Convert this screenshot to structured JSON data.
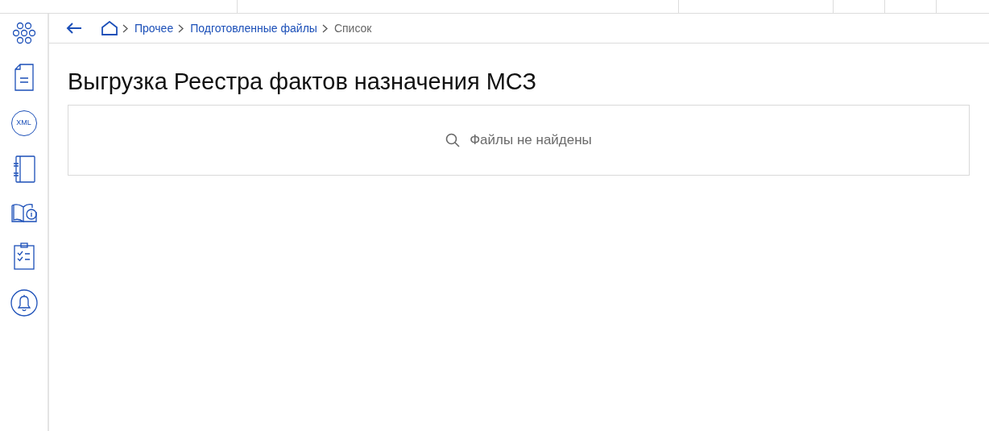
{
  "breadcrumbs": [
    {
      "label": "Прочее",
      "current": false
    },
    {
      "label": "Подготовленные файлы",
      "current": false
    },
    {
      "label": "Список",
      "current": true
    }
  ],
  "sidebar": {
    "items": [
      {
        "kind": "apps"
      },
      {
        "kind": "document"
      },
      {
        "kind": "xml",
        "label": "XML"
      },
      {
        "kind": "notebook"
      },
      {
        "kind": "book-info"
      },
      {
        "kind": "checklist"
      },
      {
        "kind": "bell"
      }
    ]
  },
  "title": "Выгрузка Реестра фактов назначения МСЗ",
  "empty_state": {
    "message": "Файлы не найдены"
  }
}
